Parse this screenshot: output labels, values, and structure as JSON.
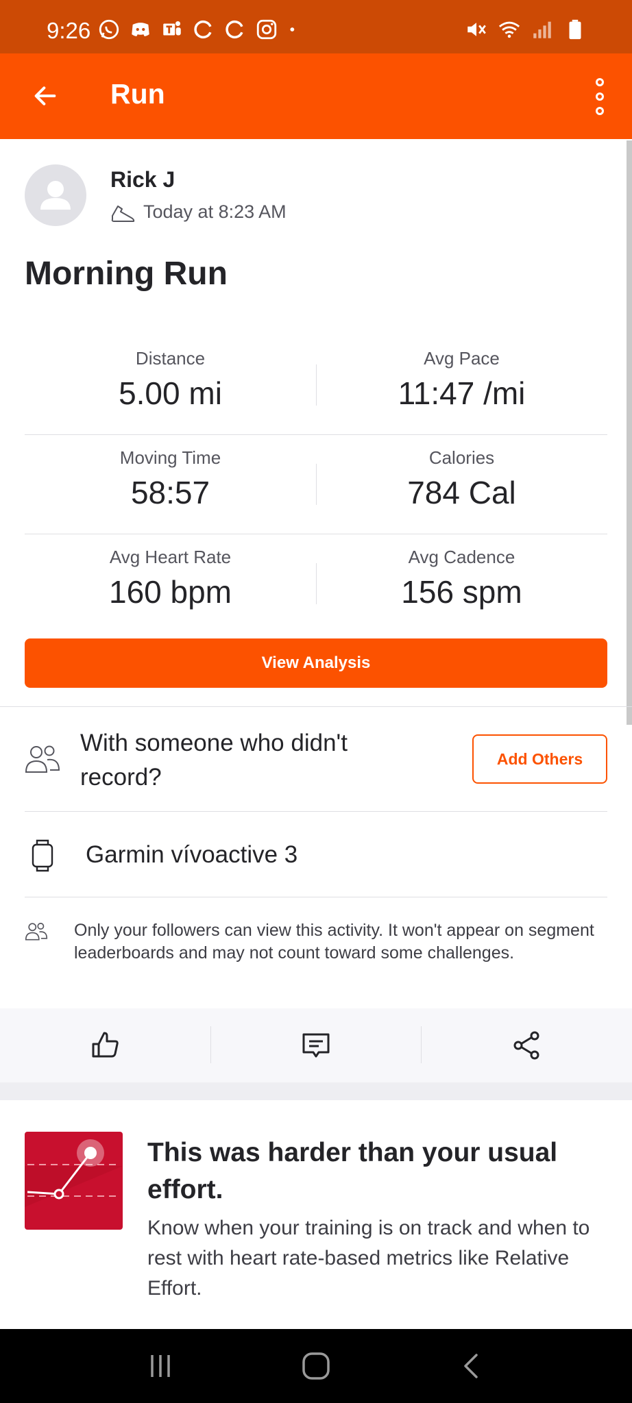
{
  "status_bar": {
    "time": "9:26"
  },
  "app_bar": {
    "title": "Run"
  },
  "athlete": {
    "name": "Rick J",
    "timestamp": "Today at 8:23 AM"
  },
  "activity": {
    "title": "Morning Run"
  },
  "stats": [
    {
      "label": "Distance",
      "value": "5.00 mi"
    },
    {
      "label": "Avg Pace",
      "value": "11:47 /mi"
    },
    {
      "label": "Moving Time",
      "value": "58:57"
    },
    {
      "label": "Calories",
      "value": "784 Cal"
    },
    {
      "label": "Avg Heart Rate",
      "value": "160 bpm"
    },
    {
      "label": "Avg Cadence",
      "value": "156 spm"
    }
  ],
  "buttons": {
    "view_analysis": "View Analysis",
    "add_others": "Add Others"
  },
  "with_someone": {
    "text": "With someone who didn't record?"
  },
  "device": {
    "name": "Garmin vívoactive 3"
  },
  "privacy": {
    "text": "Only your followers can view this activity. It won't appear on segment leaderboards and may not count toward some challenges."
  },
  "promo": {
    "title": "This was harder than your usual effort.",
    "body": "Know when your training is on track and when to rest with heart rate-based metrics like Relative Effort."
  },
  "colors": {
    "brand": "#fc5200",
    "status_bar": "#cc4a05"
  },
  "icons": {
    "action_bar": [
      "thumbs-up-icon",
      "comment-icon",
      "share-icon"
    ]
  }
}
